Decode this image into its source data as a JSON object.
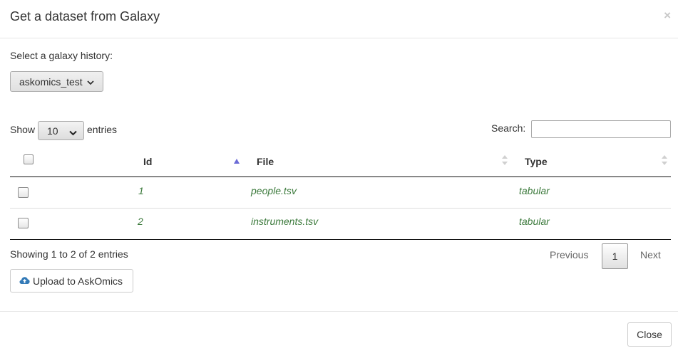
{
  "modal": {
    "title": "Get a dataset from Galaxy",
    "close_x": "×"
  },
  "history": {
    "label": "Select a galaxy history:",
    "selected": "askomics_test"
  },
  "length_menu": {
    "show": "Show",
    "selected": "10",
    "entries": "entries"
  },
  "search": {
    "label": "Search:",
    "value": "",
    "placeholder": ""
  },
  "table": {
    "columns": [
      "Id",
      "File",
      "Type"
    ],
    "sorted_column": "Id",
    "sort_direction": "ascending",
    "rows": [
      {
        "id": "1",
        "file": "people.tsv",
        "type": "tabular",
        "checked": false
      },
      {
        "id": "2",
        "file": "instruments.tsv",
        "type": "tabular",
        "checked": false
      }
    ]
  },
  "info": "Showing 1 to 2 of 2 entries",
  "pagination": {
    "previous": "Previous",
    "current_page": "1",
    "next": "Next"
  },
  "upload": {
    "label": "Upload to AskOmics",
    "icon": "cloud-upload-icon"
  },
  "footer": {
    "close_label": "Close"
  },
  "colors": {
    "cell_text": "#3c7a3c",
    "sort_active": "#6b6bd6",
    "sort_inactive": "#d0d0d0",
    "upload_icon": "#337ab7"
  }
}
